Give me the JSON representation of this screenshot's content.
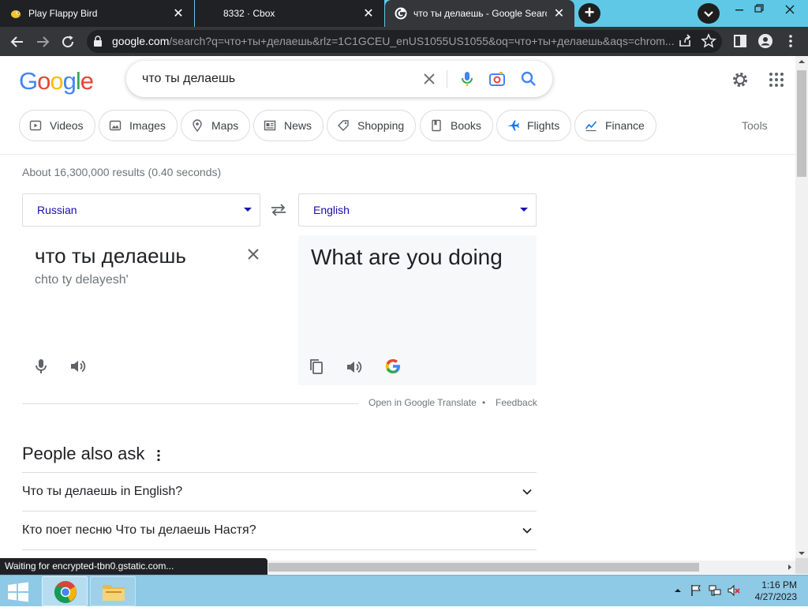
{
  "browser": {
    "tabs": [
      {
        "title": "Play Flappy Bird",
        "favicon": "flappy-bird-icon"
      },
      {
        "title": "8332 · Cbox",
        "favicon": "none"
      },
      {
        "title": "что ты делаешь - Google Search",
        "favicon": "google-icon",
        "active": true
      }
    ],
    "new_tab": "+",
    "url_host": "google.com",
    "url_rest": "/search?q=что+ты+делаешь&rlz=1C1GCEU_enUS1055US1055&oq=что+ты+делаешь&aqs=chrom...",
    "status": "Waiting for encrypted-tbn0.gstatic.com..."
  },
  "google": {
    "logo_letters": [
      "G",
      "o",
      "o",
      "g",
      "l",
      "e"
    ],
    "query": "что ты делаешь",
    "chips": [
      "Videos",
      "Images",
      "Maps",
      "News",
      "Shopping",
      "Books",
      "Flights",
      "Finance"
    ],
    "tools": "Tools",
    "stats": "About 16,300,000 results (0.40 seconds)"
  },
  "translate": {
    "source_lang": "Russian",
    "target_lang": "English",
    "source_text": "что ты делаешь",
    "transliteration": "chto ty delayesh'",
    "target_text": "What are you doing",
    "open_link": "Open in Google Translate",
    "separator": "•",
    "feedback": "Feedback"
  },
  "people_also_ask": {
    "title": "People also ask",
    "questions": [
      "Что ты делаешь in English?",
      "Кто поет песню Что ты делаешь Настя?"
    ]
  },
  "taskbar": {
    "time": "1:16 PM",
    "date": "4/27/2023"
  },
  "colors": {
    "tabstrip": "#5fc8e7",
    "toolbar": "#35363a",
    "link_blue": "#1a0dab",
    "taskbar": "#8ec9e6"
  }
}
